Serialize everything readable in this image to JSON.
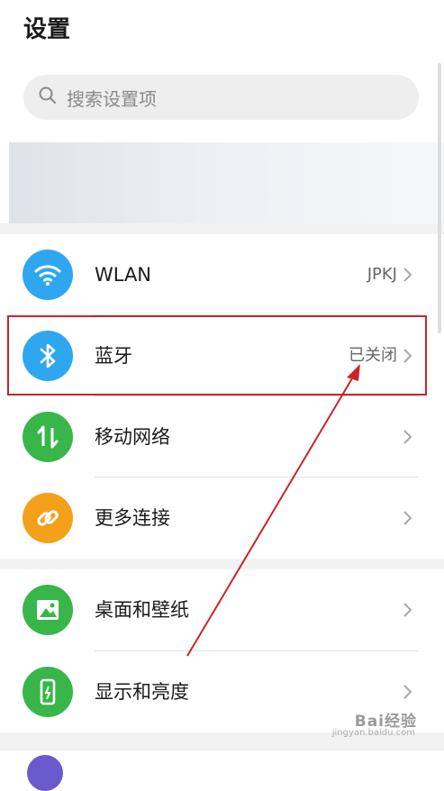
{
  "page": {
    "title": "设置"
  },
  "search": {
    "placeholder": "搜索设置项"
  },
  "rows": [
    {
      "label": "WLAN",
      "value": "JPKJ",
      "icon": "wifi-icon",
      "color": "#2ea7f0"
    },
    {
      "label": "蓝牙",
      "value": "已关闭",
      "icon": "bluetooth-icon",
      "color": "#2ea7f0"
    },
    {
      "label": "移动网络",
      "value": "",
      "icon": "mobile-data-icon",
      "color": "#38b64a"
    },
    {
      "label": "更多连接",
      "value": "",
      "icon": "link-icon",
      "color": "#f5a01a"
    },
    {
      "label": "桌面和壁纸",
      "value": "",
      "icon": "image-icon",
      "color": "#38b64a"
    },
    {
      "label": "显示和亮度",
      "value": "",
      "icon": "phone-brightness-icon",
      "color": "#38b64a"
    }
  ],
  "annotation": {
    "highlight_color": "#c8252a"
  },
  "watermark": {
    "text": "Bai经验",
    "sub": "jingyan.baidu.com"
  }
}
